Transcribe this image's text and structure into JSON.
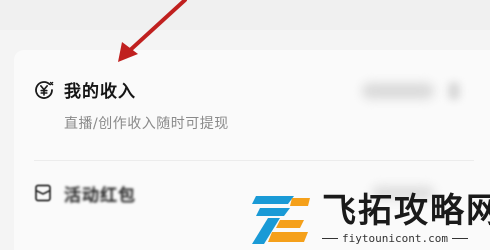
{
  "income": {
    "title": "我的收入",
    "subtitle": "直播/创作收入随时可提现",
    "icon": "yuan-coin-icon"
  },
  "red_packet": {
    "title": "活动红包",
    "icon": "red-packet-icon"
  },
  "annotation": {
    "arrow_color": "#c0201f"
  },
  "watermark": {
    "brand": "飞拓攻略网",
    "url": "fiytounicont.com",
    "logo_colors": [
      "#1a9ad6",
      "#f5a01a"
    ]
  }
}
